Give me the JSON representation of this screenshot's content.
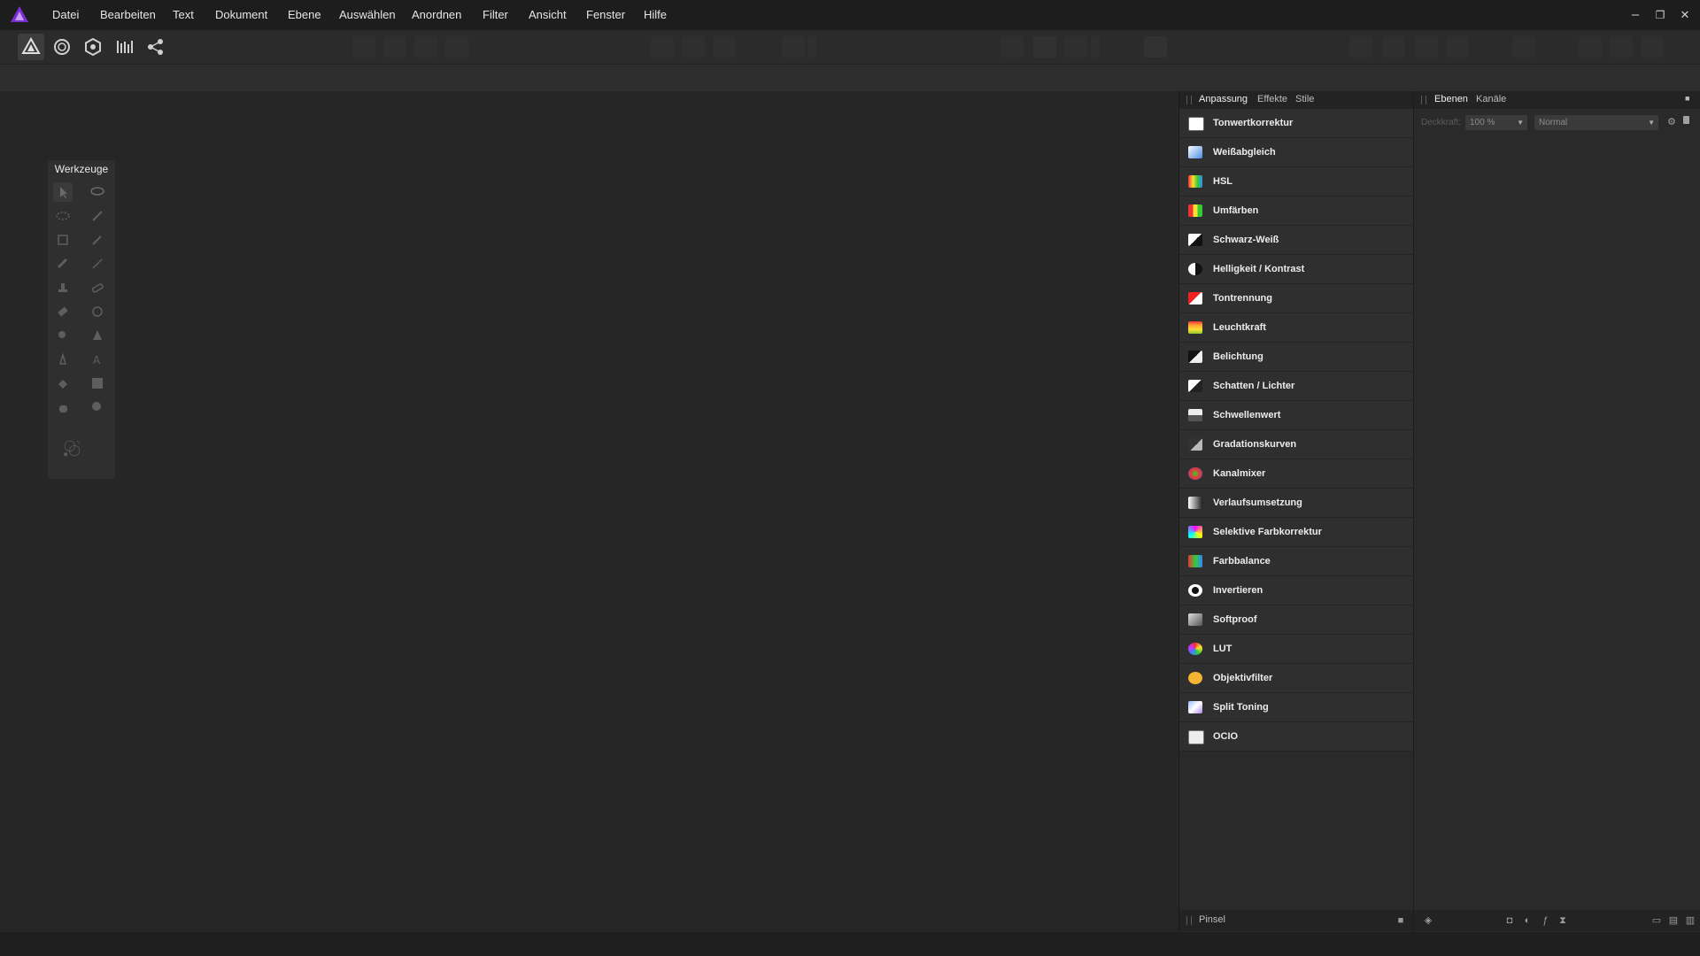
{
  "menu": [
    "Datei",
    "Bearbeiten",
    "Text",
    "Dokument",
    "Ebene",
    "Auswählen",
    "Anordnen",
    "Filter",
    "Ansicht",
    "Fenster",
    "Hilfe"
  ],
  "window": {
    "minimize": "–",
    "restore": "❐",
    "close": "✕"
  },
  "tools_panel": {
    "title": "Werkzeuge"
  },
  "adjustment_panel": {
    "tabs": [
      "Anpassung",
      "Effekte",
      "Stile"
    ],
    "active_tab": "Anpassung",
    "items": [
      {
        "label": "Tonwertkorrektur",
        "icon": "levels-icon"
      },
      {
        "label": "Weißabgleich",
        "icon": "white-balance-icon"
      },
      {
        "label": "HSL",
        "icon": "hsl-icon"
      },
      {
        "label": "Umfärben",
        "icon": "recolor-icon"
      },
      {
        "label": "Schwarz-Weiß",
        "icon": "black-white-icon"
      },
      {
        "label": "Helligkeit / Kontrast",
        "icon": "brightness-contrast-icon"
      },
      {
        "label": "Tontrennung",
        "icon": "posterize-icon"
      },
      {
        "label": "Leuchtkraft",
        "icon": "vibrance-icon"
      },
      {
        "label": "Belichtung",
        "icon": "exposure-icon"
      },
      {
        "label": "Schatten / Lichter",
        "icon": "shadows-highlights-icon"
      },
      {
        "label": "Schwellenwert",
        "icon": "threshold-icon"
      },
      {
        "label": "Gradationskurven",
        "icon": "curves-icon"
      },
      {
        "label": "Kanalmixer",
        "icon": "channel-mixer-icon"
      },
      {
        "label": "Verlaufsumsetzung",
        "icon": "gradient-map-icon"
      },
      {
        "label": "Selektive Farbkorrektur",
        "icon": "selective-color-icon"
      },
      {
        "label": "Farbbalance",
        "icon": "color-balance-icon"
      },
      {
        "label": "Invertieren",
        "icon": "invert-icon"
      },
      {
        "label": "Softproof",
        "icon": "soft-proof-icon"
      },
      {
        "label": "LUT",
        "icon": "lut-icon"
      },
      {
        "label": "Objektivfilter",
        "icon": "lens-filter-icon"
      },
      {
        "label": "Split Toning",
        "icon": "split-toning-icon"
      },
      {
        "label": "OCIO",
        "icon": "ocio-icon"
      }
    ],
    "bottom_tab": "Pinsel"
  },
  "layers_panel": {
    "tabs": [
      "Ebenen",
      "Kanäle"
    ],
    "active_tab": "Ebenen",
    "opacity_label": "Deckkraft:",
    "opacity_value": "100 %",
    "blend_mode": "Normal"
  },
  "colors": {
    "accent": "#a04ee0",
    "panel": "#2f2f2f",
    "background": "#262626"
  }
}
